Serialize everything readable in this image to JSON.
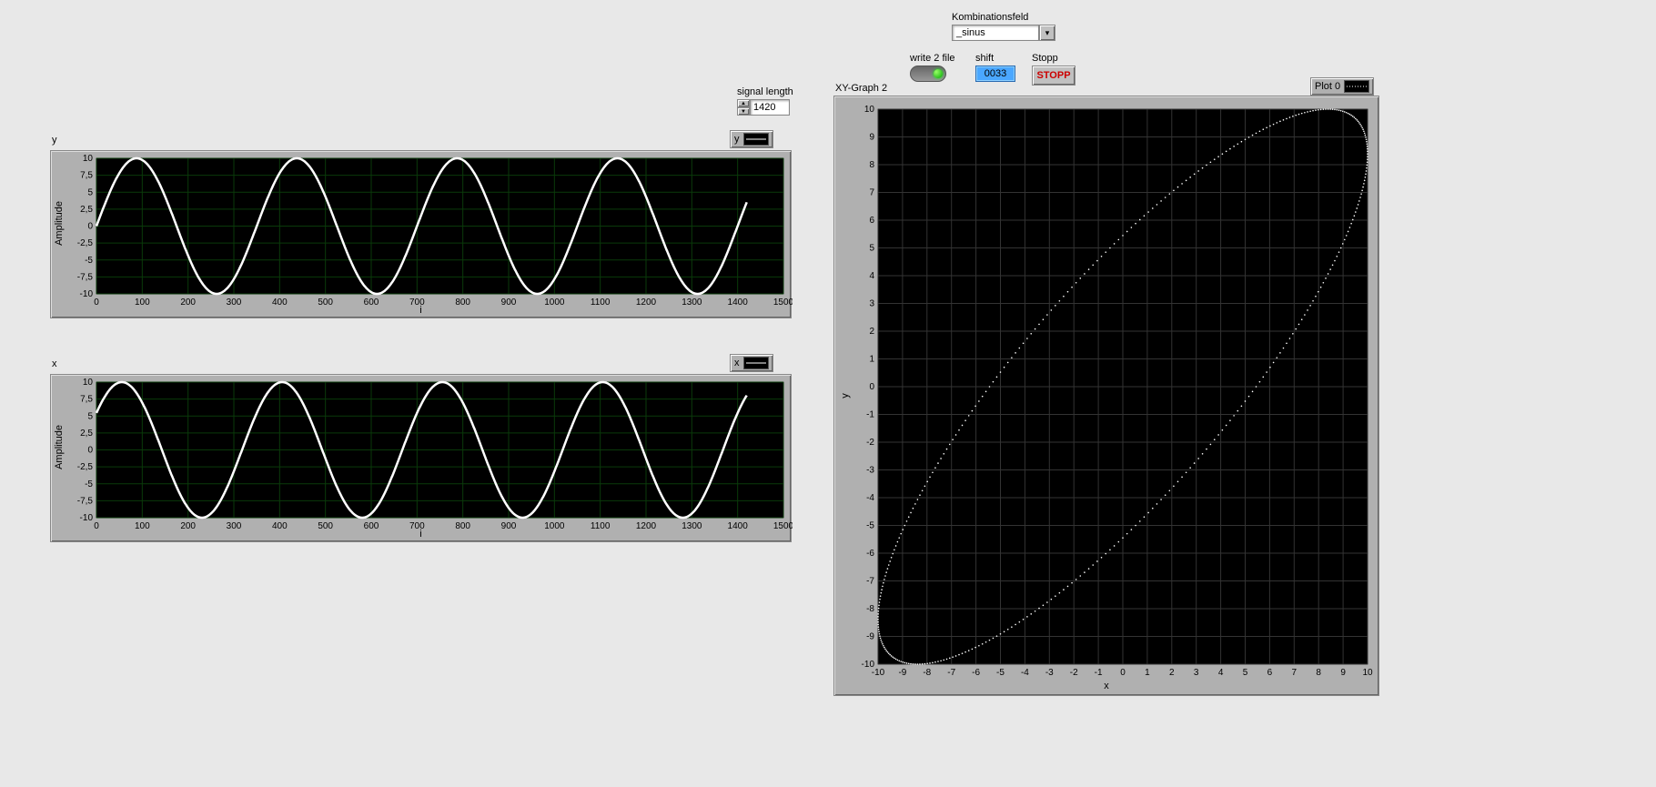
{
  "controls": {
    "signal_length": {
      "label": "signal length",
      "value": "1420"
    },
    "combo": {
      "label": "Kombinationsfeld",
      "value": "_sinus"
    },
    "write2file": {
      "label": "write 2 file"
    },
    "shift": {
      "label": "shift",
      "value": "0033"
    },
    "stop": {
      "label": "Stopp",
      "button": "STOPP"
    }
  },
  "charts": {
    "y": {
      "title": "y",
      "legend": "y",
      "ylabel": "Amplitude",
      "xlabel": "i"
    },
    "x": {
      "title": "x",
      "legend": "x",
      "ylabel": "Amplitude",
      "xlabel": "i"
    },
    "xy": {
      "title": "XY-Graph 2",
      "legend": "Plot 0",
      "ylabel": "y",
      "xlabel": "x"
    }
  },
  "chart_data": [
    {
      "type": "line",
      "name": "y",
      "title": "y",
      "xlabel": "i",
      "ylabel": "Amplitude",
      "xlim": [
        0,
        1500
      ],
      "ylim": [
        -10,
        10
      ],
      "xticks": [
        0,
        100,
        200,
        300,
        400,
        500,
        600,
        700,
        800,
        900,
        1000,
        1100,
        1200,
        1300,
        1400,
        1500
      ],
      "yticks": [
        -10,
        -7.5,
        -5,
        -2.5,
        0,
        2.5,
        5,
        7.5,
        10
      ],
      "ytick_labels": [
        "-10",
        "-7,5",
        "-5",
        "-2,5",
        "0",
        "2,5",
        "5",
        "7,5",
        "10"
      ],
      "series": [
        {
          "name": "y",
          "formula": "10*sin(2*pi*i/350)",
          "amplitude": 10,
          "period": 350,
          "phase_deg": 0,
          "n": 1420
        }
      ]
    },
    {
      "type": "line",
      "name": "x",
      "title": "x",
      "xlabel": "i",
      "ylabel": "Amplitude",
      "xlim": [
        0,
        1500
      ],
      "ylim": [
        -10,
        10
      ],
      "xticks": [
        0,
        100,
        200,
        300,
        400,
        500,
        600,
        700,
        800,
        900,
        1000,
        1100,
        1200,
        1300,
        1400,
        1500
      ],
      "yticks": [
        -10,
        -7.5,
        -5,
        -2.5,
        0,
        2.5,
        5,
        7.5,
        10
      ],
      "ytick_labels": [
        "-10",
        "-7,5",
        "-5",
        "-2,5",
        "0",
        "2,5",
        "5",
        "7,5",
        "10"
      ],
      "series": [
        {
          "name": "x",
          "formula": "10*sin(2*pi*i/350 + 33deg)",
          "amplitude": 10,
          "period": 350,
          "phase_deg": 33,
          "n": 1420
        }
      ]
    },
    {
      "type": "scatter",
      "name": "xy",
      "title": "XY-Graph 2",
      "xlabel": "x",
      "ylabel": "y",
      "xlim": [
        -10,
        10
      ],
      "ylim": [
        -10,
        10
      ],
      "xticks": [
        -10,
        -9,
        -8,
        -7,
        -6,
        -5,
        -4,
        -3,
        -2,
        -1,
        0,
        1,
        2,
        3,
        4,
        5,
        6,
        7,
        8,
        9,
        10
      ],
      "yticks": [
        -10,
        -9,
        -8,
        -7,
        -6,
        -5,
        -4,
        -3,
        -2,
        -1,
        0,
        1,
        2,
        3,
        4,
        5,
        6,
        7,
        8,
        9,
        10
      ],
      "series": [
        {
          "name": "Plot 0",
          "x_formula": "10*sin(t+33deg)",
          "y_formula": "10*sin(t)",
          "n": 1420
        }
      ]
    }
  ]
}
